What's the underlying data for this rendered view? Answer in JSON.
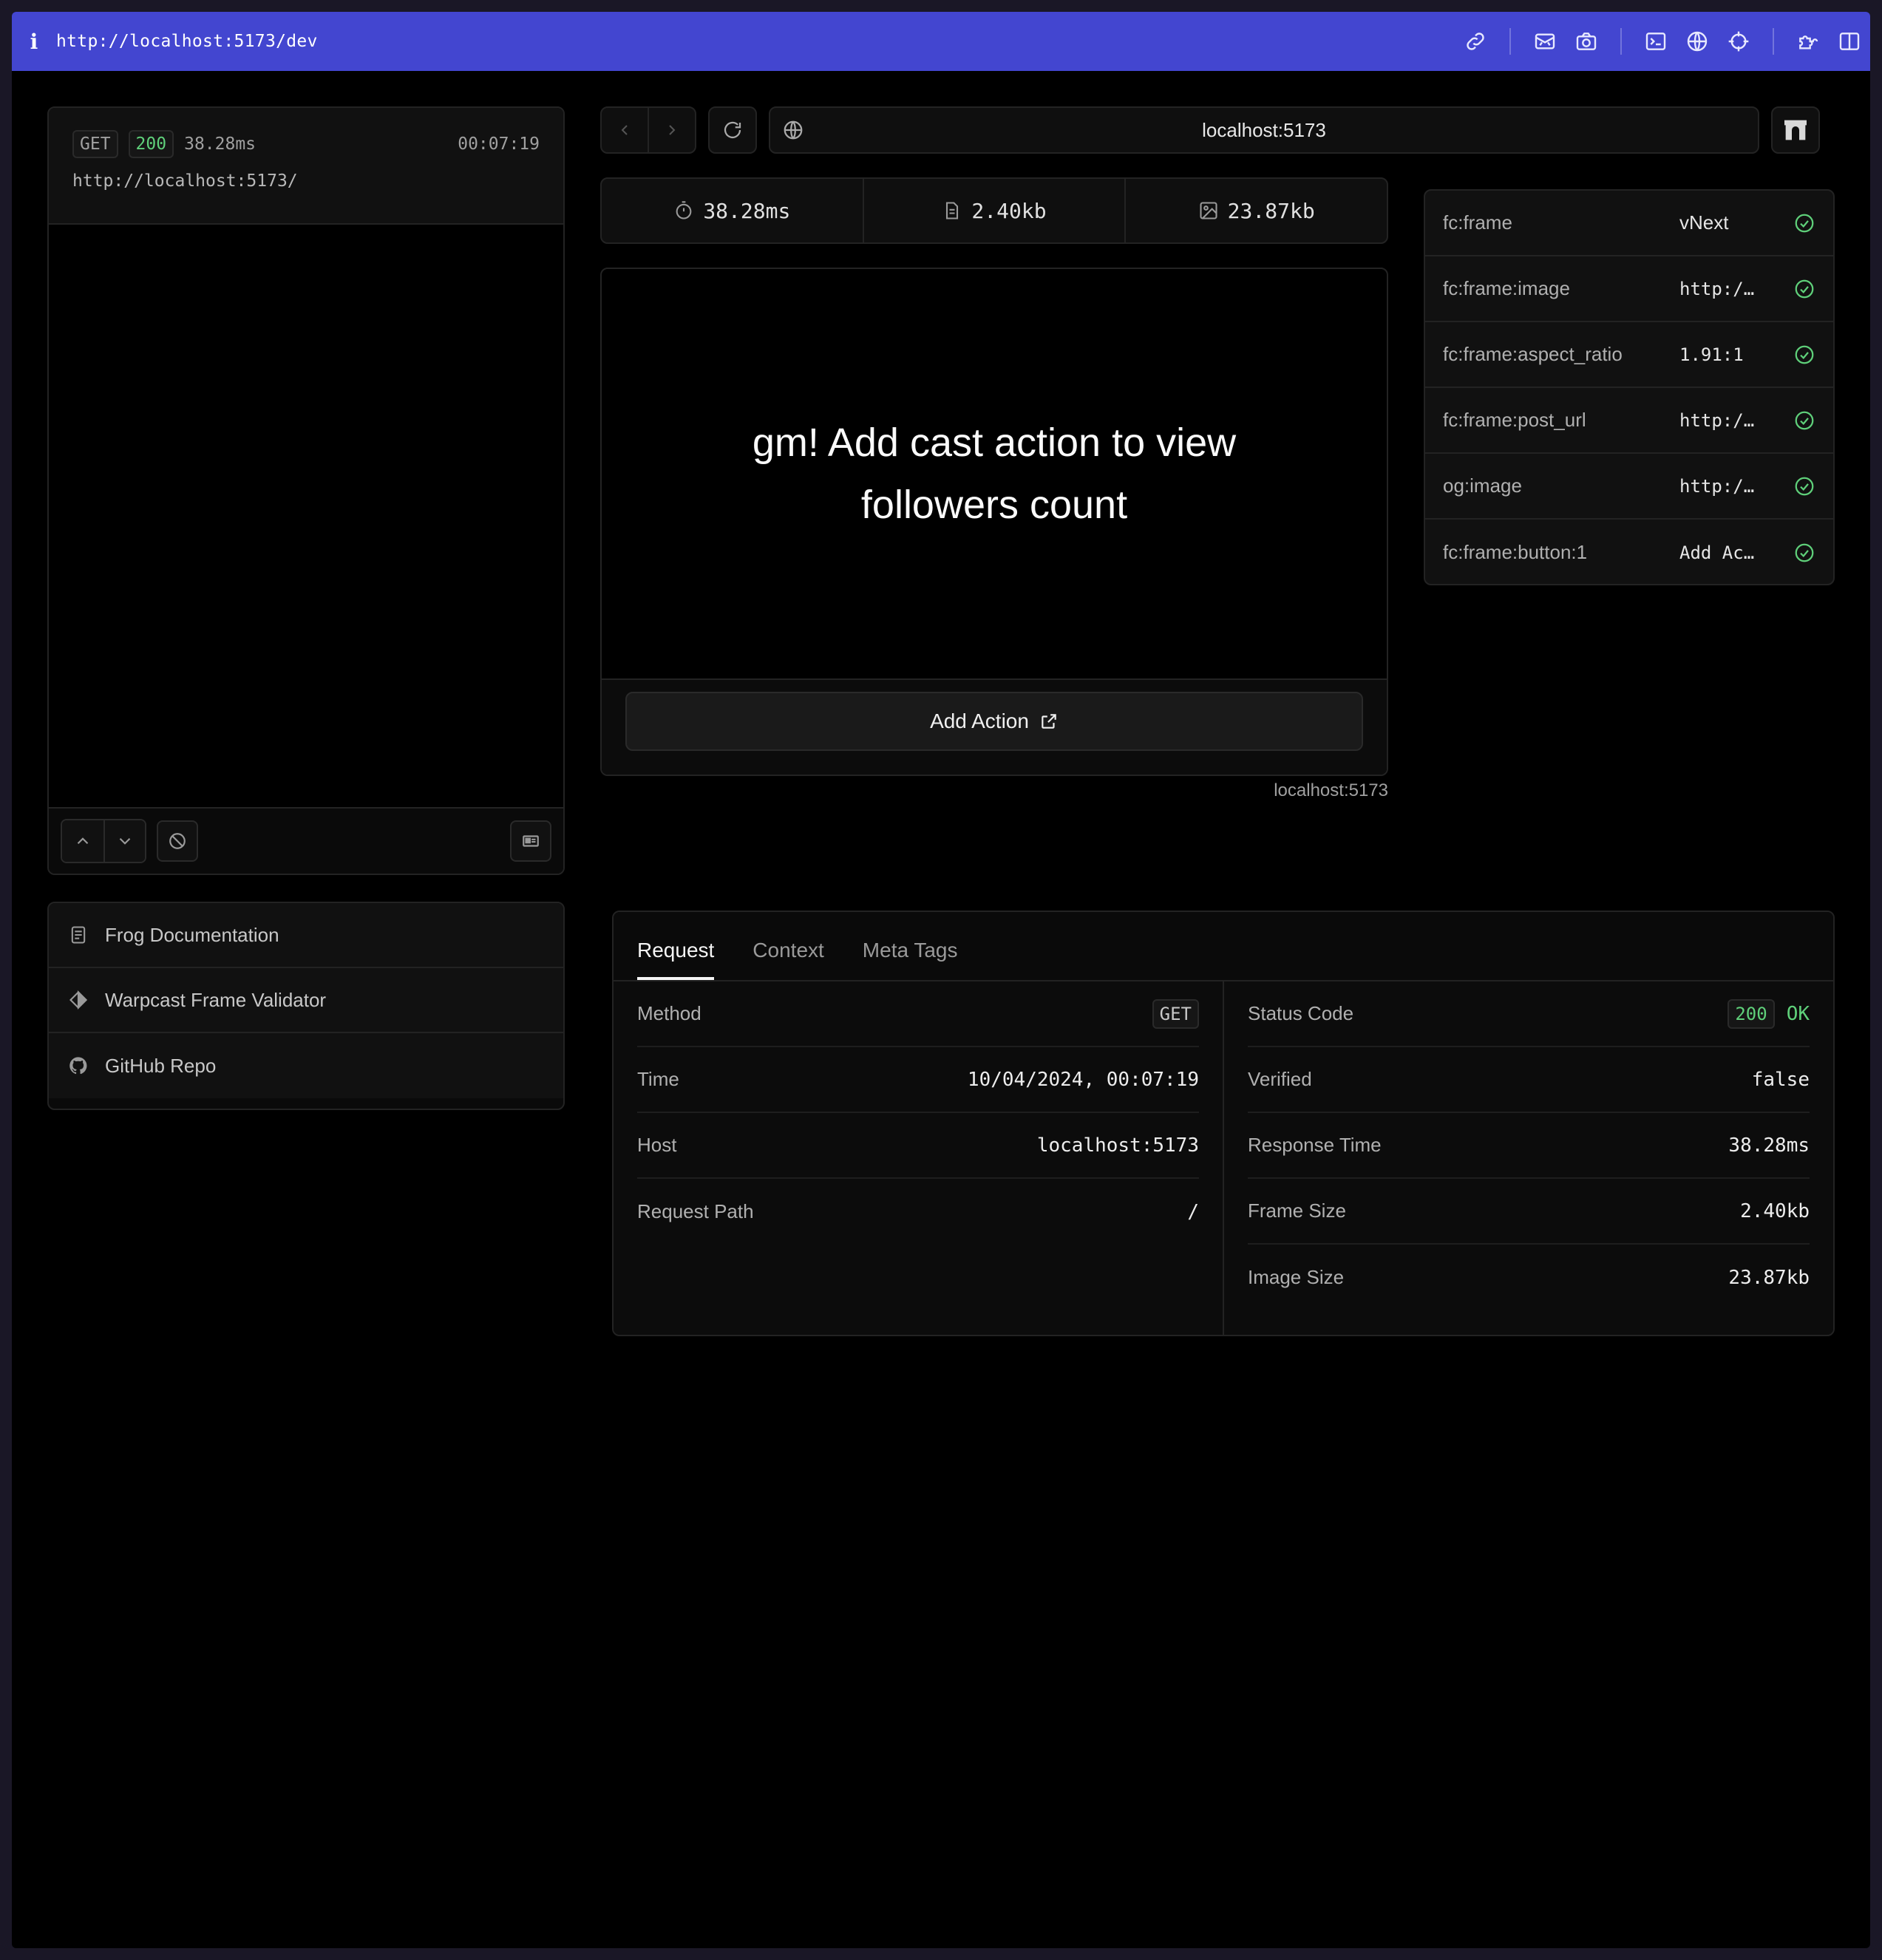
{
  "topbar": {
    "url": "http://localhost:5173/dev",
    "icons": [
      "link-icon",
      "mail-icon",
      "camera-icon",
      "terminal-icon",
      "globe-icon",
      "crosshair-icon",
      "extensions-icon",
      "sidebar-icon"
    ]
  },
  "request": {
    "method": "GET",
    "status": "200",
    "duration": "38.28ms",
    "time": "00:07:19",
    "url": "http://localhost:5173/"
  },
  "links": [
    {
      "label": "Frog Documentation",
      "icon": "document-icon"
    },
    {
      "label": "Warpcast Frame Validator",
      "icon": "diamond-icon"
    },
    {
      "label": "GitHub Repo",
      "icon": "github-icon"
    }
  ],
  "addressbar": {
    "url": "localhost:5173"
  },
  "stats": {
    "response_time": "38.28ms",
    "frame_size": "2.40kb",
    "image_size": "23.87kb"
  },
  "frame": {
    "message": "gm! Add cast action to view followers count",
    "button_label": "Add Action",
    "host": "localhost:5173"
  },
  "meta_tags": [
    {
      "key": "fc:frame",
      "value": "vNext"
    },
    {
      "key": "fc:frame:image",
      "value": "http:/…"
    },
    {
      "key": "fc:frame:aspect_ratio",
      "value": "1.91:1"
    },
    {
      "key": "fc:frame:post_url",
      "value": "http:/…"
    },
    {
      "key": "og:image",
      "value": "http:/…"
    },
    {
      "key": "fc:frame:button:1",
      "value": "Add Ac…"
    }
  ],
  "tabs": [
    "Request",
    "Context",
    "Meta Tags"
  ],
  "details": {
    "left": [
      {
        "label": "Method",
        "value": "GET"
      },
      {
        "label": "Time",
        "value": "10/04/2024, 00:07:19"
      },
      {
        "label": "Host",
        "value": "localhost:5173"
      },
      {
        "label": "Request Path",
        "value": "/"
      }
    ],
    "right": {
      "status_label": "Status Code",
      "status_code": "200",
      "status_text": "OK",
      "rows": [
        {
          "label": "Verified",
          "value": "false"
        },
        {
          "label": "Response Time",
          "value": "38.28ms"
        },
        {
          "label": "Frame Size",
          "value": "2.40kb"
        },
        {
          "label": "Image Size",
          "value": "23.87kb"
        }
      ]
    }
  },
  "colors": {
    "topbar": "#4346d0",
    "success": "#5fd07a",
    "background": "#000000"
  }
}
